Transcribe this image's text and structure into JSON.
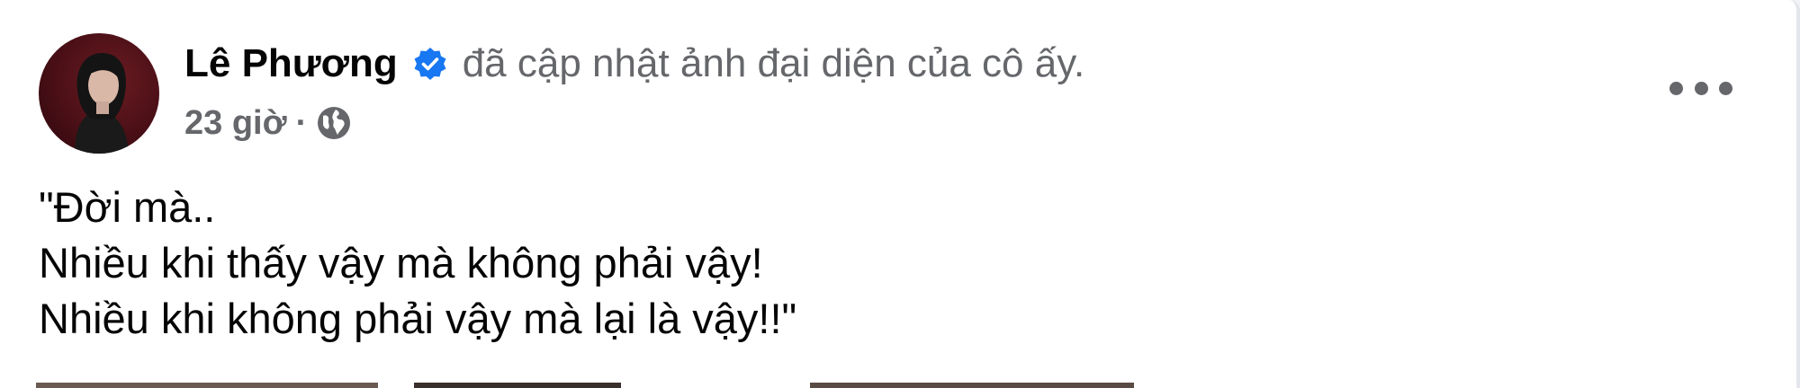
{
  "post": {
    "author_name": "Lê Phương",
    "action_text": "đã cập nhật ảnh đại diện của cô ấy.",
    "timestamp": "23 giờ",
    "separator": "·",
    "privacy_icon": "globe-icon",
    "verified_icon": "verified-badge-icon",
    "more_icon": "more-options-icon",
    "lines": [
      "\"Đời mà..",
      "Nhiều khi thấy vậy mà không phải vậy!",
      "Nhiều khi không phải vậy mà lại là vậy!!\""
    ]
  },
  "colors": {
    "verified_blue": "#1877f2",
    "secondary_text": "#65676b",
    "primary_text": "#050505"
  }
}
